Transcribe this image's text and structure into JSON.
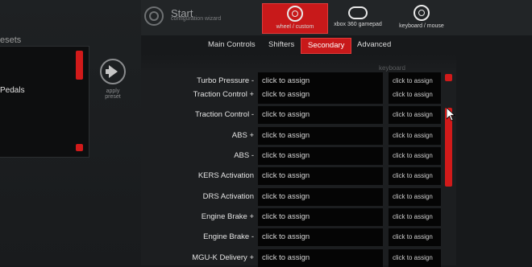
{
  "presets": {
    "title": "esets",
    "items": [
      "Pedals"
    ],
    "apply_label": "apply preset"
  },
  "header": {
    "title": "Start",
    "subtitle": "configuration wizard",
    "devices": [
      {
        "label": "wheel / custom",
        "icon": "wheel-icon",
        "selected": true
      },
      {
        "label": "xbox 360 gamepad",
        "icon": "gamepad-icon",
        "selected": false
      },
      {
        "label": "keyboard / mouse",
        "icon": "keyboard-mouse-icon",
        "selected": false
      }
    ]
  },
  "tabs": [
    {
      "label": "Main Controls"
    },
    {
      "label": "Shifters"
    },
    {
      "label": "Secondary",
      "active": true
    },
    {
      "label": "Advanced"
    }
  ],
  "list": {
    "keyboard_header": "keyboard",
    "rows": [
      {
        "label": "Turbo Pressure -",
        "assign": "click to assign",
        "kb": "click to assign"
      },
      {
        "label": "Traction Control +",
        "assign": "click to assign",
        "kb": "click to assign"
      },
      {
        "label": "Traction Control -",
        "assign": "click to assign",
        "kb": "click to assign"
      },
      {
        "label": "ABS +",
        "assign": "click to assign",
        "kb": "click to assign"
      },
      {
        "label": "ABS -",
        "assign": "click to assign",
        "kb": "click to assign"
      },
      {
        "label": "KERS Activation",
        "assign": "click to assign",
        "kb": "click to assign"
      },
      {
        "label": "DRS Activation",
        "assign": "click to assign",
        "kb": "click to assign"
      },
      {
        "label": "Engine Brake +",
        "assign": "click to assign",
        "kb": "click to assign"
      },
      {
        "label": "Engine Brake -",
        "assign": "click to assign",
        "kb": "click to assign"
      },
      {
        "label": "MGU-K Delivery +",
        "assign": "click to assign",
        "kb": "click to assign"
      }
    ]
  },
  "colors": {
    "accent": "#c8191a",
    "background": "#17191b"
  }
}
